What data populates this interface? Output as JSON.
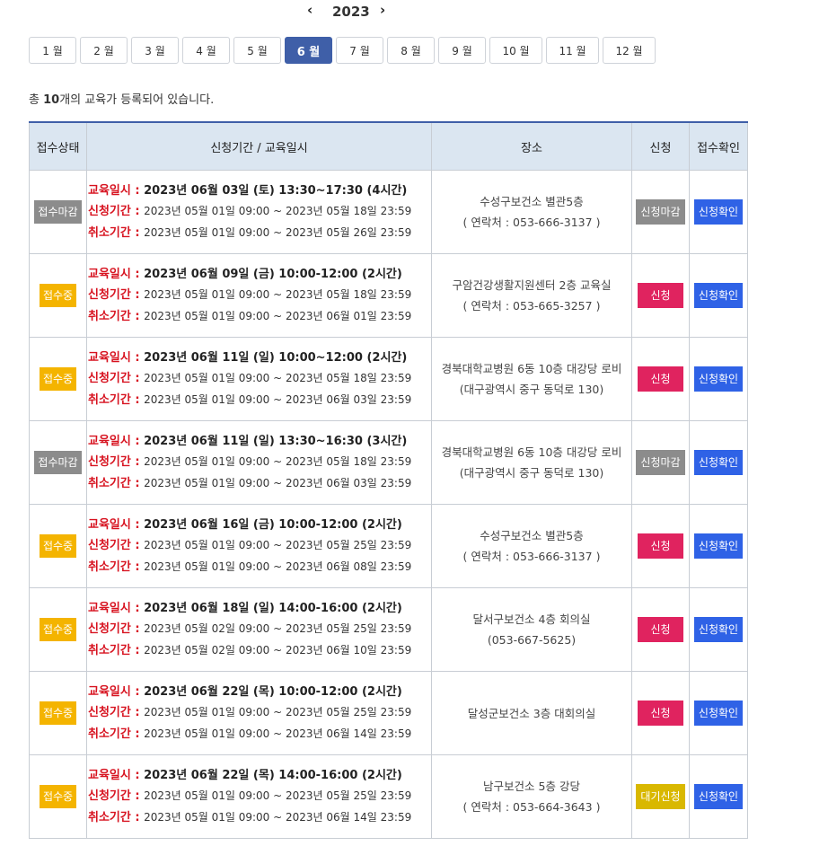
{
  "year_nav": {
    "prev": "‹",
    "year": "2023",
    "next": "›"
  },
  "months": [
    {
      "label": "1 월",
      "active": false
    },
    {
      "label": "2 월",
      "active": false
    },
    {
      "label": "3 월",
      "active": false
    },
    {
      "label": "4 월",
      "active": false
    },
    {
      "label": "5 월",
      "active": false
    },
    {
      "label": "6 월",
      "active": true
    },
    {
      "label": "7 월",
      "active": false
    },
    {
      "label": "8 월",
      "active": false
    },
    {
      "label": "9 월",
      "active": false
    },
    {
      "label": "10 월",
      "active": false
    },
    {
      "label": "11 월",
      "active": false
    },
    {
      "label": "12 월",
      "active": false
    }
  ],
  "summary": {
    "prefix": "총 ",
    "count": "10",
    "suffix": "개의 교육가 등록되어 있습니다."
  },
  "table": {
    "headers": [
      "접수상태",
      "신청기간 / 교육일시",
      "장소",
      "신청",
      "접수확인"
    ],
    "labels": {
      "edu": "교육일시 : ",
      "apply": "신청기간 : ",
      "cancel": "취소기간 : "
    },
    "rows": [
      {
        "status": "접수마감",
        "status_type": "closed",
        "edu": "2023년 06월 03일 (토) 13:30~17:30 (4시간)",
        "apply": "2023년 05월 01일 09:00 ~ 2023년 05월 18일 23:59",
        "cancel": "2023년 05월 01일 09:00 ~ 2023년 05월 26일 23:59",
        "place": "수성구보건소 별관5층",
        "contact": "( 연락처 : 053-666-3137 )",
        "apply_btn": "신청마감",
        "apply_type": "closed",
        "check_btn": "신청확인"
      },
      {
        "status": "접수중",
        "status_type": "open",
        "edu": "2023년 06월 09일 (금) 10:00-12:00 (2시간)",
        "apply": "2023년 05월 01일 09:00 ~ 2023년 05월 18일 23:59",
        "cancel": "2023년 05월 01일 09:00 ~ 2023년 06월 01일 23:59",
        "place": "구암건강생활지원센터 2층 교육실",
        "contact": "( 연락처 : 053-665-3257 )",
        "apply_btn": "신청",
        "apply_type": "apply",
        "check_btn": "신청확인"
      },
      {
        "status": "접수중",
        "status_type": "open",
        "edu": "2023년 06월 11일 (일) 10:00~12:00 (2시간)",
        "apply": "2023년 05월 01일 09:00 ~ 2023년 05월 18일 23:59",
        "cancel": "2023년 05월 01일 09:00 ~ 2023년 06월 03일 23:59",
        "place": "경북대학교병원 6동 10층 대강당 로비",
        "contact": "(대구광역시 중구 동덕로 130)",
        "apply_btn": "신청",
        "apply_type": "apply",
        "check_btn": "신청확인"
      },
      {
        "status": "접수마감",
        "status_type": "closed",
        "edu": "2023년 06월 11일 (일) 13:30~16:30 (3시간)",
        "apply": "2023년 05월 01일 09:00 ~ 2023년 05월 18일 23:59",
        "cancel": "2023년 05월 01일 09:00 ~ 2023년 06월 03일 23:59",
        "place": "경북대학교병원 6동 10층 대강당 로비",
        "contact": "(대구광역시 중구 동덕로 130)",
        "apply_btn": "신청마감",
        "apply_type": "closed",
        "check_btn": "신청확인"
      },
      {
        "status": "접수중",
        "status_type": "open",
        "edu": "2023년 06월 16일 (금) 10:00-12:00 (2시간)",
        "apply": "2023년 05월 01일 09:00 ~ 2023년 05월 25일 23:59",
        "cancel": "2023년 05월 01일 09:00 ~ 2023년 06월 08일 23:59",
        "place": "수성구보건소 별관5층",
        "contact": "( 연락처 : 053-666-3137 )",
        "apply_btn": "신청",
        "apply_type": "apply",
        "check_btn": "신청확인"
      },
      {
        "status": "접수중",
        "status_type": "open",
        "edu": "2023년 06월 18일 (일) 14:00-16:00 (2시간)",
        "apply": "2023년 05월 02일 09:00 ~ 2023년 05월 25일 23:59",
        "cancel": "2023년 05월 02일 09:00 ~ 2023년 06월 10일 23:59",
        "place": "달서구보건소 4층 회의실",
        "contact": "(053-667-5625)",
        "apply_btn": "신청",
        "apply_type": "apply",
        "check_btn": "신청확인"
      },
      {
        "status": "접수중",
        "status_type": "open",
        "edu": "2023년 06월 22일 (목) 10:00-12:00 (2시간)",
        "apply": "2023년 05월 01일 09:00 ~ 2023년 05월 25일 23:59",
        "cancel": "2023년 05월 01일 09:00 ~ 2023년 06월 14일 23:59",
        "place": "달성군보건소 3층 대회의실",
        "contact": "",
        "apply_btn": "신청",
        "apply_type": "apply",
        "check_btn": "신청확인"
      },
      {
        "status": "접수중",
        "status_type": "open",
        "edu": "2023년 06월 22일 (목) 14:00-16:00 (2시간)",
        "apply": "2023년 05월 01일 09:00 ~ 2023년 05월 25일 23:59",
        "cancel": "2023년 05월 01일 09:00 ~ 2023년 06월 14일 23:59",
        "place": "남구보건소 5층 강당",
        "contact": "( 연락처 : 053-664-3643 )",
        "apply_btn": "대기신청",
        "apply_type": "wait",
        "check_btn": "신청확인"
      }
    ]
  }
}
